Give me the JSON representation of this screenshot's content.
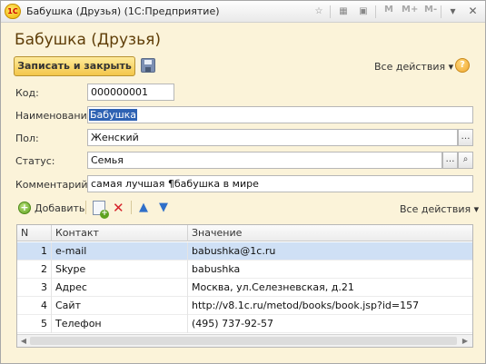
{
  "window": {
    "title": "Бабушка (Друзья)  (1С:Предприятие)",
    "logo": "1С",
    "mem_buttons": [
      "M",
      "M+",
      "M-"
    ]
  },
  "form": {
    "title": "Бабушка (Друзья)",
    "save_close_label": "Записать и закрыть",
    "all_actions_label": "Все действия ▾",
    "help_label": "?"
  },
  "fields": {
    "code": {
      "label": "Код:",
      "value": "000000001"
    },
    "name": {
      "label": "Наименование:",
      "value": "Бабушка"
    },
    "gender": {
      "label": "Пол:",
      "value": "Женский"
    },
    "status": {
      "label": "Статус:",
      "value": "Семья"
    },
    "comment": {
      "label": "Комментарий:",
      "value": "самая лучшая ¶бабушка в мире"
    }
  },
  "table_toolbar": {
    "add_label": "Добавить",
    "all_actions_label": "Все действия ▾"
  },
  "table": {
    "columns": [
      "N",
      "Контакт",
      "Значение"
    ],
    "rows": [
      {
        "n": "1",
        "contact": "e-mail",
        "value": "babushka@1c.ru"
      },
      {
        "n": "2",
        "contact": "Skype",
        "value": "babushka"
      },
      {
        "n": "3",
        "contact": "Адрес",
        "value": "Москва, ул.Селезневская, д.21"
      },
      {
        "n": "4",
        "contact": "Сайт",
        "value": "http://v8.1c.ru/metod/books/book.jsp?id=157"
      },
      {
        "n": "5",
        "contact": "Телефон",
        "value": "(495) 737-92-57"
      }
    ],
    "selected_row": 0
  },
  "colors": {
    "form_background": "#fbf3d9",
    "title_color": "#5f3e08",
    "save_button": "#f3c64a",
    "selection": "#2e62b3",
    "selected_row": "#cfe0f5"
  }
}
